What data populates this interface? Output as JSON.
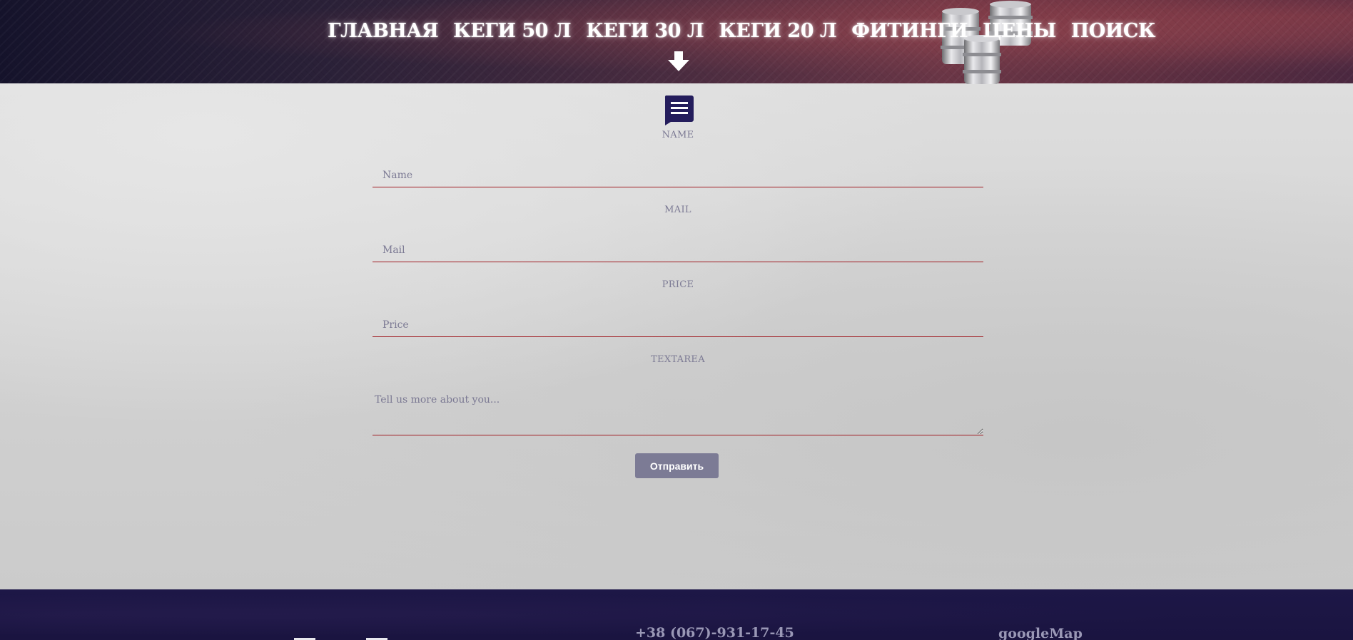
{
  "nav": {
    "items": [
      {
        "label": "ГЛАВНАЯ"
      },
      {
        "label": "КЕГИ 50 Л"
      },
      {
        "label": "КЕГИ 30 Л"
      },
      {
        "label": "КЕГИ 20 Л"
      },
      {
        "label": "ФИТИНГИ"
      },
      {
        "label": "ЦЕНЫ"
      },
      {
        "label": "ПОИСК"
      }
    ]
  },
  "form": {
    "name_label": "NAME",
    "name_placeholder": "Name",
    "mail_label": "MAIL",
    "mail_placeholder": "Mail",
    "price_label": "PRICE",
    "price_placeholder": "Price",
    "textarea_label": "TEXTAREA",
    "textarea_placeholder": "Tell us more about you...",
    "submit_label": "Отправить"
  },
  "footer": {
    "phone": "+38 (067)-931-17-45",
    "map_link": "googleMap"
  },
  "icons": {
    "header_arrow": "arrow-down-icon",
    "form_icon": "chat-bubble-icon",
    "kegs_image": "beer-kegs-image"
  },
  "colors": {
    "accent_underline": "#a01c22",
    "label_color": "#7c7a94",
    "button_bg": "#7c7b95",
    "footer_bg": "#1d1747",
    "icon_navy": "#241d5c"
  }
}
